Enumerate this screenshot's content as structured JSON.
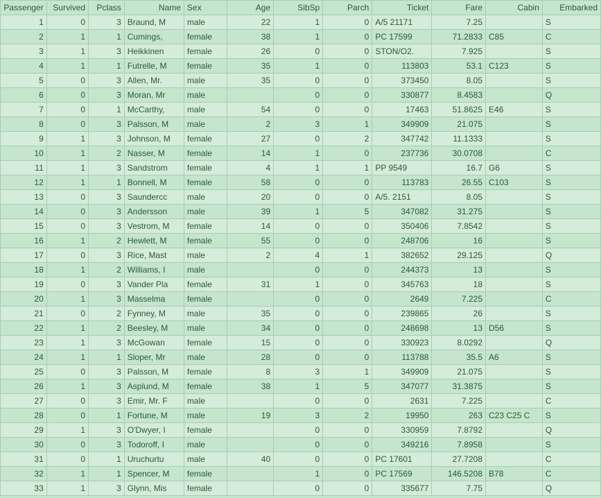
{
  "headers": [
    "Passenger",
    "Survived",
    "Pclass",
    "Name",
    "Sex",
    "Age",
    "SibSp",
    "Parch",
    "Ticket",
    "Fare",
    "Cabin",
    "Embarked"
  ],
  "align": [
    "num",
    "num",
    "num",
    "txt",
    "txt",
    "num",
    "num",
    "num",
    "num",
    "num",
    "txt",
    "txt"
  ],
  "headerAlign": [
    "right",
    "right",
    "right",
    "right",
    "left",
    "right",
    "right",
    "right",
    "right",
    "right",
    "right",
    "right"
  ],
  "rows": [
    [
      "1",
      "0",
      "3",
      "Braund, M",
      "male",
      "22",
      "1",
      "0",
      "A/5 21171",
      "7.25",
      "",
      "S"
    ],
    [
      "2",
      "1",
      "1",
      "Cumings, ",
      "female",
      "38",
      "1",
      "0",
      "PC 17599",
      "71.2833",
      "C85",
      "C"
    ],
    [
      "3",
      "1",
      "3",
      "Heikkinen",
      "female",
      "26",
      "0",
      "0",
      "STON/O2.",
      "7.925",
      "",
      "S"
    ],
    [
      "4",
      "1",
      "1",
      "Futrelle, M",
      "female",
      "35",
      "1",
      "0",
      "113803",
      "53.1",
      "C123",
      "S"
    ],
    [
      "5",
      "0",
      "3",
      "Allen, Mr.",
      "male",
      "35",
      "0",
      "0",
      "373450",
      "8.05",
      "",
      "S"
    ],
    [
      "6",
      "0",
      "3",
      "Moran, Mr",
      "male",
      "",
      "0",
      "0",
      "330877",
      "8.4583",
      "",
      "Q"
    ],
    [
      "7",
      "0",
      "1",
      "McCarthy,",
      "male",
      "54",
      "0",
      "0",
      "17463",
      "51.8625",
      "E46",
      "S"
    ],
    [
      "8",
      "0",
      "3",
      "Palsson, M",
      "male",
      "2",
      "3",
      "1",
      "349909",
      "21.075",
      "",
      "S"
    ],
    [
      "9",
      "1",
      "3",
      "Johnson, M",
      "female",
      "27",
      "0",
      "2",
      "347742",
      "11.1333",
      "",
      "S"
    ],
    [
      "10",
      "1",
      "2",
      "Nasser, M",
      "female",
      "14",
      "1",
      "0",
      "237736",
      "30.0708",
      "",
      "C"
    ],
    [
      "11",
      "1",
      "3",
      "Sandstrom",
      "female",
      "4",
      "1",
      "1",
      "PP 9549",
      "16.7",
      "G6",
      "S"
    ],
    [
      "12",
      "1",
      "1",
      "Bonnell, M",
      "female",
      "58",
      "0",
      "0",
      "113783",
      "26.55",
      "C103",
      "S"
    ],
    [
      "13",
      "0",
      "3",
      "Saundercc",
      "male",
      "20",
      "0",
      "0",
      "A/5. 2151",
      "8.05",
      "",
      "S"
    ],
    [
      "14",
      "0",
      "3",
      "Andersson",
      "male",
      "39",
      "1",
      "5",
      "347082",
      "31.275",
      "",
      "S"
    ],
    [
      "15",
      "0",
      "3",
      "Vestrom, M",
      "female",
      "14",
      "0",
      "0",
      "350406",
      "7.8542",
      "",
      "S"
    ],
    [
      "16",
      "1",
      "2",
      "Hewlett, M",
      "female",
      "55",
      "0",
      "0",
      "248706",
      "16",
      "",
      "S"
    ],
    [
      "17",
      "0",
      "3",
      "Rice, Mast",
      "male",
      "2",
      "4",
      "1",
      "382652",
      "29.125",
      "",
      "Q"
    ],
    [
      "18",
      "1",
      "2",
      "Williams, I",
      "male",
      "",
      "0",
      "0",
      "244373",
      "13",
      "",
      "S"
    ],
    [
      "19",
      "0",
      "3",
      "Vander Pla",
      "female",
      "31",
      "1",
      "0",
      "345763",
      "18",
      "",
      "S"
    ],
    [
      "20",
      "1",
      "3",
      "Masselma",
      "female",
      "",
      "0",
      "0",
      "2649",
      "7.225",
      "",
      "C"
    ],
    [
      "21",
      "0",
      "2",
      "Fynney, M",
      "male",
      "35",
      "0",
      "0",
      "239865",
      "26",
      "",
      "S"
    ],
    [
      "22",
      "1",
      "2",
      "Beesley, M",
      "male",
      "34",
      "0",
      "0",
      "248698",
      "13",
      "D56",
      "S"
    ],
    [
      "23",
      "1",
      "3",
      "McGowan",
      "female",
      "15",
      "0",
      "0",
      "330923",
      "8.0292",
      "",
      "Q"
    ],
    [
      "24",
      "1",
      "1",
      "Sloper, Mr",
      "male",
      "28",
      "0",
      "0",
      "113788",
      "35.5",
      "A6",
      "S"
    ],
    [
      "25",
      "0",
      "3",
      "Palsson, M",
      "female",
      "8",
      "3",
      "1",
      "349909",
      "21.075",
      "",
      "S"
    ],
    [
      "26",
      "1",
      "3",
      "Asplund, M",
      "female",
      "38",
      "1",
      "5",
      "347077",
      "31.3875",
      "",
      "S"
    ],
    [
      "27",
      "0",
      "3",
      "Emir, Mr. F",
      "male",
      "",
      "0",
      "0",
      "2631",
      "7.225",
      "",
      "C"
    ],
    [
      "28",
      "0",
      "1",
      "Fortune, M",
      "male",
      "19",
      "3",
      "2",
      "19950",
      "263",
      "C23 C25 C",
      "S"
    ],
    [
      "29",
      "1",
      "3",
      "O'Dwyer, I",
      "female",
      "",
      "0",
      "0",
      "330959",
      "7.8792",
      "",
      "Q"
    ],
    [
      "30",
      "0",
      "3",
      "Todoroff, I",
      "male",
      "",
      "0",
      "0",
      "349216",
      "7.8958",
      "",
      "S"
    ],
    [
      "31",
      "0",
      "1",
      "Uruchurtu",
      "male",
      "40",
      "0",
      "0",
      "PC 17601",
      "27.7208",
      "",
      "C"
    ],
    [
      "32",
      "1",
      "1",
      "Spencer, M",
      "female",
      "",
      "1",
      "0",
      "PC 17569",
      "146.5208",
      "B78",
      "C"
    ],
    [
      "33",
      "1",
      "3",
      "Glynn, Mis",
      "female",
      "",
      "0",
      "0",
      "335677",
      "7.75",
      "",
      "Q"
    ]
  ]
}
